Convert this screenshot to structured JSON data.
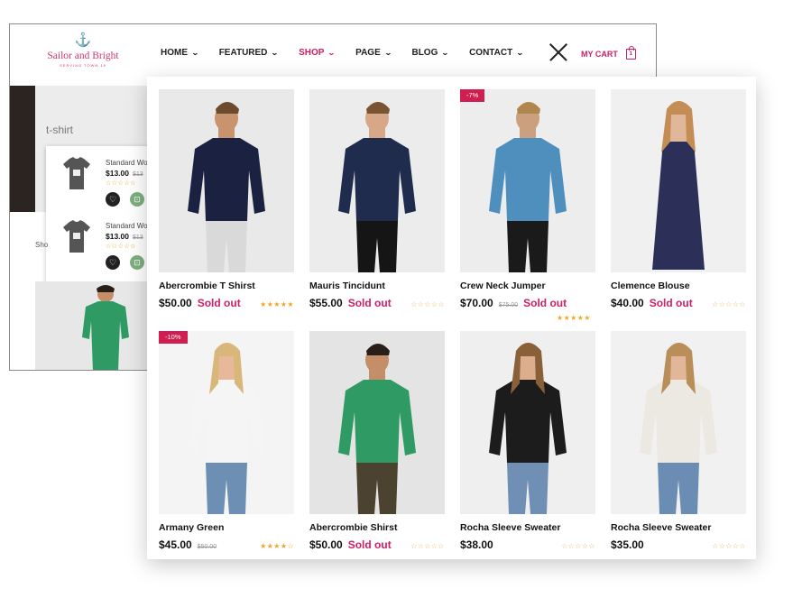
{
  "brand": {
    "name": "Sailor and Bright",
    "tagline": "SERVING TOWN 19"
  },
  "nav": [
    {
      "label": "HOME"
    },
    {
      "label": "FEATURED"
    },
    {
      "label": "SHOP",
      "active": true
    },
    {
      "label": "PAGE"
    },
    {
      "label": "BLOG"
    },
    {
      "label": "CONTACT"
    }
  ],
  "cart": {
    "label": "MY CART",
    "count": "1"
  },
  "category_title": "t-shirt",
  "sidebar_label": "Sho",
  "mini_cart": [
    {
      "name": "Standard Wo",
      "price": "$13.00",
      "old_price": "$13",
      "stars": "☆☆☆☆☆"
    },
    {
      "name": "Standard Wo",
      "price": "$13.00",
      "old_price": "$13",
      "stars": "☆☆☆☆☆"
    }
  ],
  "products": [
    {
      "name": "Abercrombie T Shirst",
      "price": "$50.00",
      "old_price": "",
      "sold_out": "Sold out",
      "badge": "",
      "stars": "★★★★★",
      "rating": 5,
      "shirt": "#1b2140",
      "pants": "#d9d9d9",
      "skin": "#c9936d",
      "bg": "#e9e9e9",
      "hair": "#6b4a2e"
    },
    {
      "name": "Mauris Tincidunt",
      "price": "$55.00",
      "old_price": "",
      "sold_out": "Sold out",
      "badge": "",
      "stars": "☆☆☆☆☆",
      "rating": 0,
      "shirt": "#1f2c4d",
      "pants": "#151515",
      "skin": "#d7a788",
      "bg": "#ececec",
      "hair": "#7a5432"
    },
    {
      "name": "Crew Neck Jumper",
      "price": "$70.00",
      "old_price": "$75.00",
      "sold_out": "Sold out",
      "badge": "-7%",
      "stars": "★★★★★",
      "rating": 5,
      "shirt": "#4e8fbd",
      "pants": "#1a1a1a",
      "skin": "#caa07e",
      "bg": "#ededed",
      "hair": "#b0864e"
    },
    {
      "name": "Clemence Blouse",
      "price": "$40.00",
      "old_price": "",
      "sold_out": "Sold out",
      "badge": "",
      "stars": "☆☆☆☆☆",
      "rating": 0,
      "shirt": "#2c2f58",
      "pants": "#2c2f58",
      "skin": "#e1b79a",
      "bg": "#f0f0f0",
      "hair": "#c48d55"
    },
    {
      "name": "Armany Green",
      "price": "$45.00",
      "old_price": "$50.00",
      "sold_out": "",
      "badge": "-10%",
      "stars": "★★★★☆",
      "rating": 4,
      "shirt": "#f5f5f5",
      "pants": "#6d8fb4",
      "skin": "#e7b899",
      "bg": "#f4f4f4",
      "hair": "#d9b67a"
    },
    {
      "name": "Abercrombie Shirst",
      "price": "$50.00",
      "old_price": "",
      "sold_out": "Sold out",
      "badge": "",
      "stars": "☆☆☆☆☆",
      "rating": 0,
      "shirt": "#2f9a63",
      "pants": "#4c4230",
      "skin": "#c48e68",
      "bg": "#e4e4e4",
      "hair": "#2a1f18"
    },
    {
      "name": "Rocha Sleeve Sweater",
      "price": "$38.00",
      "old_price": "",
      "sold_out": "",
      "badge": "",
      "stars": "☆☆☆☆☆",
      "rating": 0,
      "shirt": "#1c1c1c",
      "pants": "#6f8fb5",
      "skin": "#dcae8c",
      "bg": "#efefef",
      "hair": "#8a6038"
    },
    {
      "name": "Rocha Sleeve Sweater",
      "price": "$35.00",
      "old_price": "",
      "sold_out": "",
      "badge": "",
      "stars": "☆☆☆☆☆",
      "rating": 0,
      "shirt": "#ece8e2",
      "pants": "#6c8db3",
      "skin": "#e2b698",
      "bg": "#f1f1f1",
      "hair": "#b98e58"
    }
  ],
  "colors": {
    "accent": "#d01e66",
    "badge": "#d01e50",
    "star": "#f0a62a"
  }
}
